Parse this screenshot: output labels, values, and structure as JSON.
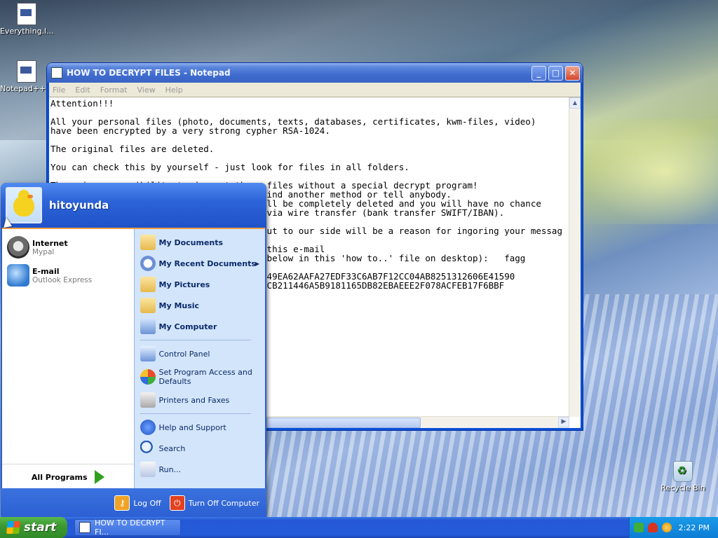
{
  "desktop": {
    "icons": [
      {
        "label": "Everything.l...",
        "icon": "exe-icon"
      },
      {
        "label": "Notepad++...",
        "icon": "exe-icon"
      },
      {
        "label": "Recycle Bin",
        "icon": "recycle-bin-icon"
      }
    ]
  },
  "notepad": {
    "title": "HOW TO DECRYPT FILES - Notepad",
    "controls": {
      "minimize": "_",
      "maximize": "□",
      "close": "✕"
    },
    "menu": [
      "File",
      "Edit",
      "Format",
      "View",
      "Help"
    ],
    "text": "Attention!!!\n\nAll your personal files (photo, documents, texts, databases, certificates, kwm-files, video)\nhave been encrypted by a very strong cypher RSA-1024.\n\nThe original files are deleted.\n\nYou can check this by yourself - just look for files in all folders.\n\nThere is no possibility to decrypt these files without a special decrypt program!\nNobody can help you - even don't try to find another method or tell anybody.\nAlso after n number of hours decrypted will be completely deleted and you will have no chance\nto get it. We accept only bitcoins and $ via wire transfer (bank transfer SWIFT/IBAN).\n\nAny attempts to get back your files without to our side will be a reason for ingoring your messag\n\nTo get a key contact us: send request on this e-mail\nwith the code of your personal ID (shown below in this 'how to..' file on desktop):   fagg\n\nYour personal ID: 9C4D5E4F8A0B2C3D087070749EA62AAFA27EDF33C6AB7F12CC04AB8251312606E41590\nA1B2C3D4E5F60718293A4B5C6D7E8F903B69F4674CB211446A5B9181165DB82EBAEEE2F078ACFEB17F6BBF"
  },
  "start_menu": {
    "username": "hitoyunda",
    "pinned": [
      {
        "title": "Internet",
        "subtitle": "Mypal",
        "icon": "raccoon-browser-icon"
      },
      {
        "title": "E-mail",
        "subtitle": "Outlook Express",
        "icon": "outlook-express-icon"
      }
    ],
    "all_programs": "All Programs",
    "right": {
      "my_documents": "My Documents",
      "my_recent_documents": "My Recent Documents",
      "my_pictures": "My Pictures",
      "my_music": "My Music",
      "my_computer": "My Computer",
      "control_panel": "Control Panel",
      "set_program_access": "Set Program Access and Defaults",
      "printers_faxes": "Printers and Faxes",
      "help_support": "Help and Support",
      "search": "Search",
      "run": "Run..."
    },
    "footer": {
      "log_off": "Log Off",
      "turn_off": "Turn Off Computer"
    }
  },
  "taskbar": {
    "start_label": "start",
    "task_button": "HOW TO DECRYPT FI...",
    "clock": "2:22 PM"
  }
}
